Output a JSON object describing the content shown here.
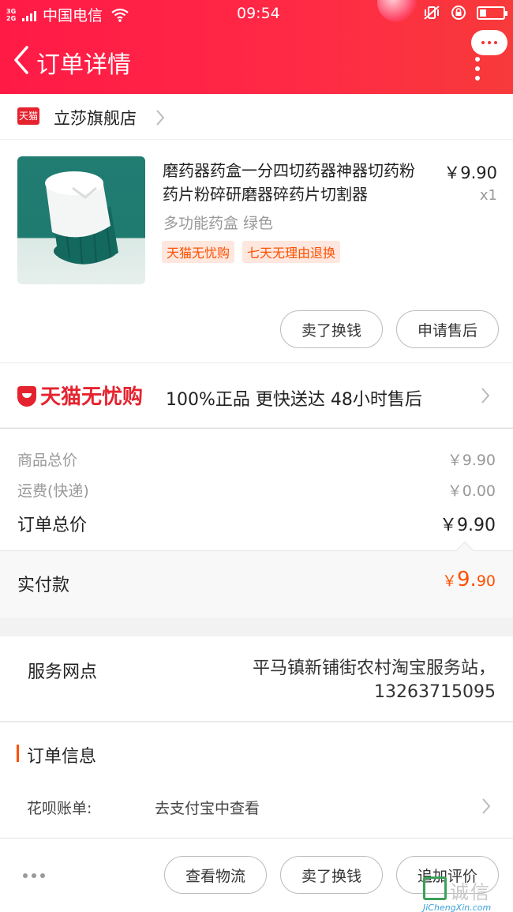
{
  "status_bar": {
    "network": "3G 2G",
    "carrier": "中国电信",
    "time": "09:54"
  },
  "header": {
    "title": "订单详情"
  },
  "store": {
    "badge": "天猫",
    "name": "立莎旗舰店"
  },
  "product": {
    "name": "磨药器药盒一分四切药器神器切药粉药片粉碎研磨器碎药片切割器",
    "price": "￥9.90",
    "quantity": "x1",
    "spec": "多功能药盒 绿色",
    "tags": [
      "天猫无忧购",
      "七天无理由退换"
    ]
  },
  "item_actions": {
    "sell_label": "卖了换钱",
    "after_sale_label": "申请售后"
  },
  "promo": {
    "brand": "天猫无忧购",
    "text": "100%正品  更快送达  48小时售后"
  },
  "prices": {
    "goods_label": "商品总价",
    "goods_value": "￥9.90",
    "shipping_label": "运费(快递)",
    "shipping_value": "￥0.00",
    "total_label": "订单总价",
    "total_value": "￥9.90",
    "paid_label": "实付款",
    "paid_currency": "￥",
    "paid_integer": "9.",
    "paid_decimal": "90"
  },
  "service": {
    "label": "服务网点",
    "text": "平马镇新铺街农村淘宝服务站，13263715095"
  },
  "order_info": {
    "title": "订单信息",
    "huabei_label": "花呗账单:",
    "huabei_value": "去支付宝中查看"
  },
  "bottom_actions": {
    "logistics_label": "查看物流",
    "sell_label": "卖了换钱",
    "review_label": "追加评价"
  },
  "watermark": {
    "text": "诚信",
    "sub": "JiChengXin.com"
  },
  "colors": {
    "header_red": "#ff1a46",
    "accent_orange": "#ff5000",
    "tmall_red": "#e5232f"
  }
}
